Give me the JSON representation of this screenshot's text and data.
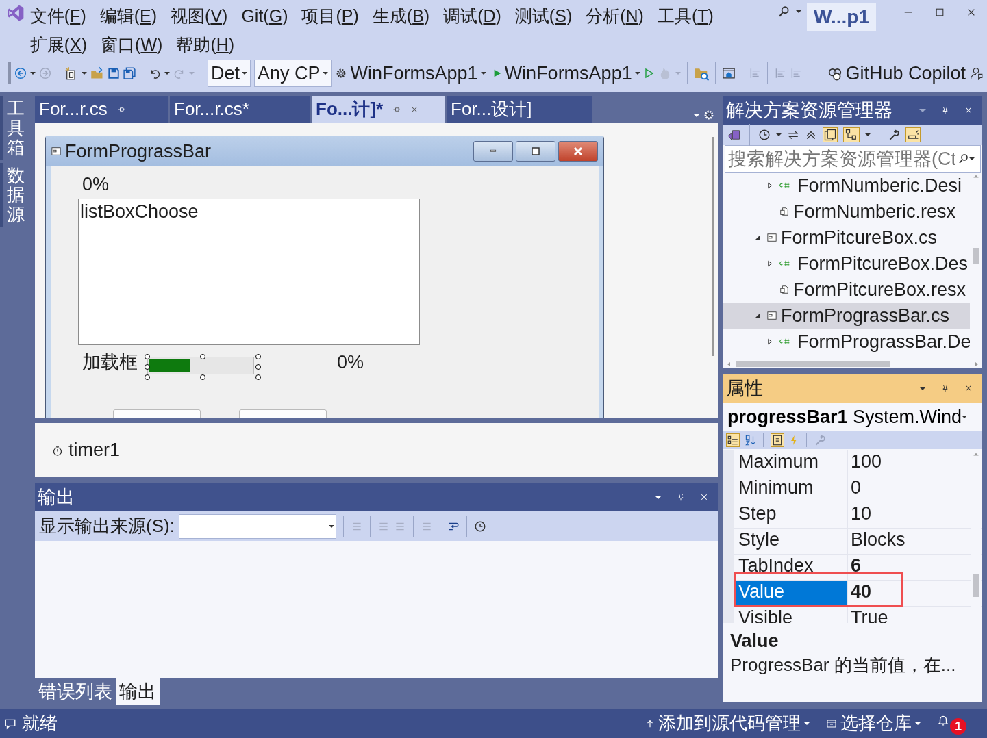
{
  "menu": [
    "文件(F)",
    "编辑(E)",
    "视图(V)",
    "Git(G)",
    "项目(P)",
    "生成(B)",
    "调试(D)",
    "测试(S)",
    "分析(N)",
    "工具(T)",
    "扩展(X)",
    "窗口(W)",
    "帮助(H)"
  ],
  "title_badge": "W...p1",
  "toolbar": {
    "configuration": "Det",
    "platform": "Any CP",
    "startup_project": "WinFormsApp1",
    "run_target": "WinFormsApp1",
    "copilot": "GitHub Copilot"
  },
  "side_tabs": [
    "工具箱",
    "数据源"
  ],
  "doc_tabs": [
    {
      "label": "For...r.cs",
      "selected": false,
      "pinned": true
    },
    {
      "label": "For...r.cs*",
      "selected": false,
      "pinned": false
    },
    {
      "label": "Fo...计]*",
      "selected": true,
      "pinned": true
    },
    {
      "label": "For...设计]",
      "selected": false,
      "pinned": false
    }
  ],
  "designer": {
    "form_title": "FormPrograssBar",
    "top_label": "0%",
    "listbox": "listBoxChoose",
    "load_label": "加载框",
    "progress": {
      "level": 0.4,
      "selected": true
    },
    "percent_label": "0%",
    "buttons": [
      {
        "kind": "button"
      },
      {
        "kind": "button"
      }
    ]
  },
  "tray": [
    "timer1"
  ],
  "output": {
    "title": "输出",
    "source_label": "显示输出来源(S):",
    "bottom_tabs": [
      {
        "label": "错误列表",
        "selected": false
      },
      {
        "label": "输出",
        "selected": true
      }
    ]
  },
  "solution_explorer": {
    "title": "解决方案资源管理器",
    "search": {
      "placeholder": "搜索解决方案资源管理器(Ct"
    },
    "tree": [
      {
        "children": [
          {
            "label": "FormNumberic.Desi",
            "kind": "csharp",
            "expanded": false,
            "selected": false
          },
          {
            "label": "FormNumberic.resx",
            "kind": "resx",
            "selected": false
          }
        ]
      },
      {
        "label": "FormPitcureBox.cs",
        "kind": "form",
        "expanded": true,
        "selected": false,
        "children": [
          {
            "label": "FormPitcureBox.Des",
            "kind": "csharp",
            "expanded": false,
            "selected": false
          },
          {
            "label": "FormPitcureBox.resx",
            "kind": "resx",
            "selected": false
          }
        ]
      },
      {
        "label": "FormPrograssBar.cs",
        "kind": "form",
        "expanded": true,
        "selected": true,
        "children": [
          {
            "label": "FormPrograssBar.De",
            "kind": "csharp",
            "expanded": false,
            "selected": false
          }
        ]
      }
    ]
  },
  "properties": {
    "title": "属性",
    "object": "**progressBar1** System.Wind",
    "rows": [
      {
        "name": "Maximum",
        "value": "100",
        "modified": false,
        "selected": false,
        "annotated": false
      },
      {
        "name": "Minimum",
        "value": "0",
        "modified": false,
        "selected": false,
        "annotated": false
      },
      {
        "name": "Step",
        "value": "10",
        "modified": false,
        "selected": false,
        "annotated": false
      },
      {
        "name": "Style",
        "value": "Blocks",
        "modified": false,
        "selected": false,
        "annotated": false
      },
      {
        "name": "TabIndex",
        "value": "6",
        "modified": true,
        "selected": false,
        "annotated": false
      },
      {
        "name": "Value",
        "value": "40",
        "modified": true,
        "selected": true,
        "annotated": true
      },
      {
        "name": "Visible",
        "value": "True",
        "modified": false,
        "selected": false,
        "annotated": false
      }
    ],
    "description_title": "Value",
    "description": "ProgressBar 的当前值，在..."
  },
  "status_bar": {
    "ready": "就绪",
    "source_control": "添加到源代码管理",
    "repository": "选择仓库",
    "notifications": "1"
  }
}
